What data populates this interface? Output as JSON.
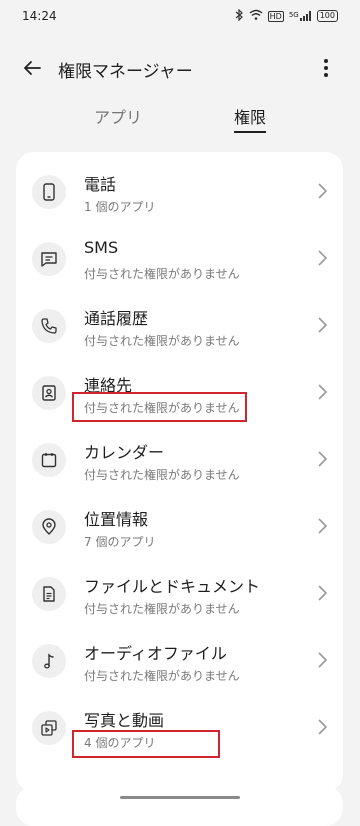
{
  "status_bar": {
    "time": "14:24",
    "signal_text": "5G",
    "battery": "100"
  },
  "header": {
    "title": "権限マネージャー"
  },
  "tabs": [
    {
      "label": "アプリ",
      "selected": false
    },
    {
      "label": "権限",
      "selected": true
    }
  ],
  "permissions": [
    {
      "icon": "phone-device-icon",
      "title": "電話",
      "subtitle": "1 個のアプリ"
    },
    {
      "icon": "sms-icon",
      "title": "SMS",
      "subtitle": "付与された権限がありません"
    },
    {
      "icon": "call-log-icon",
      "title": "通話履歴",
      "subtitle": "付与された権限がありません"
    },
    {
      "icon": "contacts-icon",
      "title": "連絡先",
      "subtitle": "付与された権限がありません"
    },
    {
      "icon": "calendar-icon",
      "title": "カレンダー",
      "subtitle": "付与された権限がありません"
    },
    {
      "icon": "location-icon",
      "title": "位置情報",
      "subtitle": "7 個のアプリ"
    },
    {
      "icon": "document-icon",
      "title": "ファイルとドキュメント",
      "subtitle": "付与された権限がありません"
    },
    {
      "icon": "music-note-icon",
      "title": "オーディオファイル",
      "subtitle": "付与された権限がありません"
    },
    {
      "icon": "photos-videos-icon",
      "title": "写真と動画",
      "subtitle": "4 個のアプリ"
    }
  ],
  "colors": {
    "highlight": "#d0242f",
    "background": "#f3f3f3",
    "card": "#ffffff"
  }
}
